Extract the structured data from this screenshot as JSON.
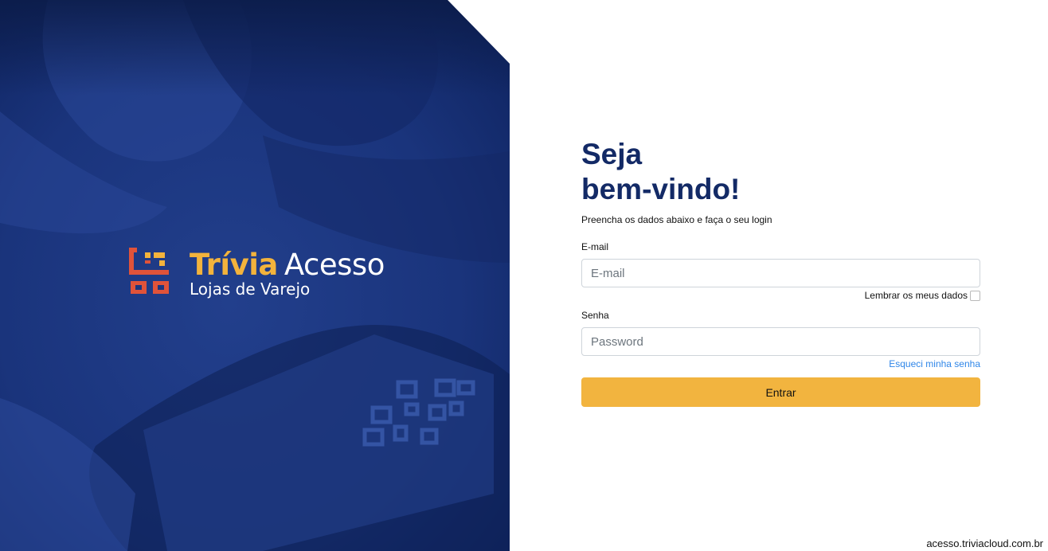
{
  "colors": {
    "hero_blue": "#1b3680",
    "hero_dark": "#0c1e4f",
    "title_navy": "#132a66",
    "accent_yellow": "#f3b33c",
    "button_yellow": "#f2b43f",
    "logo_red": "#e0533a",
    "link_blue": "#2f86e8"
  },
  "brand": {
    "logo_icon": "qr-code-logo-icon",
    "name_accent": "Trívia",
    "name_rest": "Acesso",
    "subtitle": "Lojas de Varejo"
  },
  "login": {
    "title_line1": "Seja",
    "title_line2": "bem-vindo!",
    "subtitle": "Preencha os dados abaixo e faça o seu login",
    "email": {
      "label": "E-mail",
      "placeholder": "E-mail",
      "value": ""
    },
    "remember_label": "Lembrar os meus dados",
    "remember_checked": false,
    "password": {
      "label": "Senha",
      "placeholder": "Password",
      "value": ""
    },
    "forgot_label": "Esqueci minha senha",
    "submit_label": "Entrar"
  },
  "footer": {
    "url": "acesso.triviacloud.com.br"
  }
}
